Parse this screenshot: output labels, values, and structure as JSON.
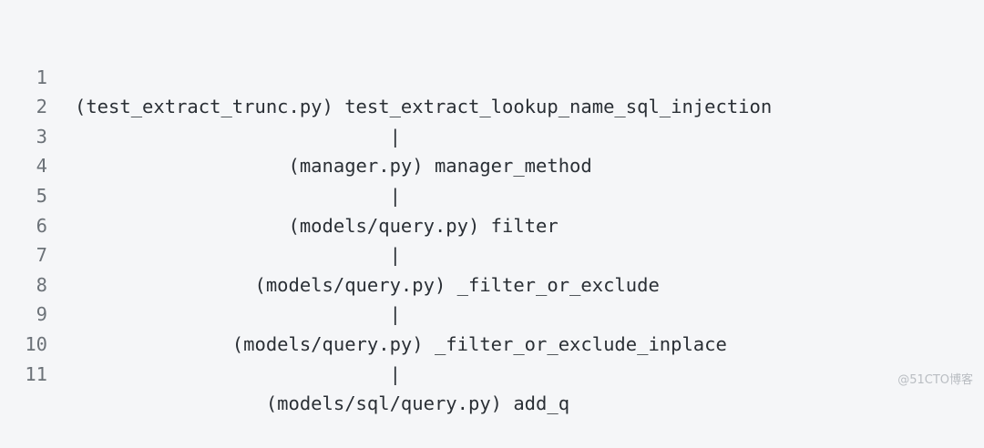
{
  "code": {
    "lines": [
      {
        "number": "1",
        "text": "(test_extract_trunc.py) test_extract_lookup_name_sql_injection"
      },
      {
        "number": "2",
        "text": "                            |"
      },
      {
        "number": "3",
        "text": "                   (manager.py) manager_method"
      },
      {
        "number": "4",
        "text": "                            |"
      },
      {
        "number": "5",
        "text": "                   (models/query.py) filter"
      },
      {
        "number": "6",
        "text": "                            |"
      },
      {
        "number": "7",
        "text": "                (models/query.py) _filter_or_exclude"
      },
      {
        "number": "8",
        "text": "                            |"
      },
      {
        "number": "9",
        "text": "              (models/query.py) _filter_or_exclude_inplace"
      },
      {
        "number": "10",
        "text": "                            |"
      },
      {
        "number": "11",
        "text": "                 (models/sql/query.py) add_q"
      }
    ]
  },
  "watermark": "@51CTO博客"
}
